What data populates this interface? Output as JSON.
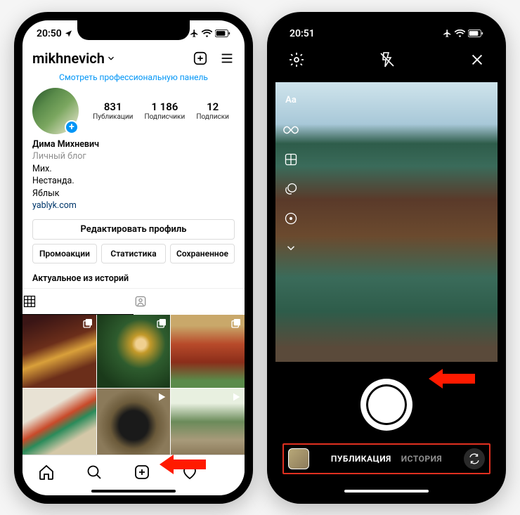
{
  "left": {
    "status": {
      "time": "20:50"
    },
    "header": {
      "username": "mikhnevich"
    },
    "pro_link": "Смотреть профессиональную панель",
    "stats": {
      "posts": {
        "count": "831",
        "label": "Публикации"
      },
      "followers": {
        "count": "1 186",
        "label": "Подписчики"
      },
      "following": {
        "count": "12",
        "label": "Подписки"
      }
    },
    "bio": {
      "name": "Дима Михневич",
      "category": "Личный блог",
      "line1": "Мих.",
      "line2": "Нестанда.",
      "line3": "Яблык",
      "link": "yablyk.com"
    },
    "edit_profile": "Редактировать профиль",
    "chips": {
      "promo": "Промоакции",
      "stats": "Статистика",
      "saved": "Сохраненное"
    },
    "highlights_title": "Актуальное из историй"
  },
  "right": {
    "status": {
      "time": "20:51"
    },
    "modes": {
      "post": "ПУБЛИКАЦИЯ",
      "story": "ИСТОРИЯ"
    },
    "side_text": "Aa"
  }
}
